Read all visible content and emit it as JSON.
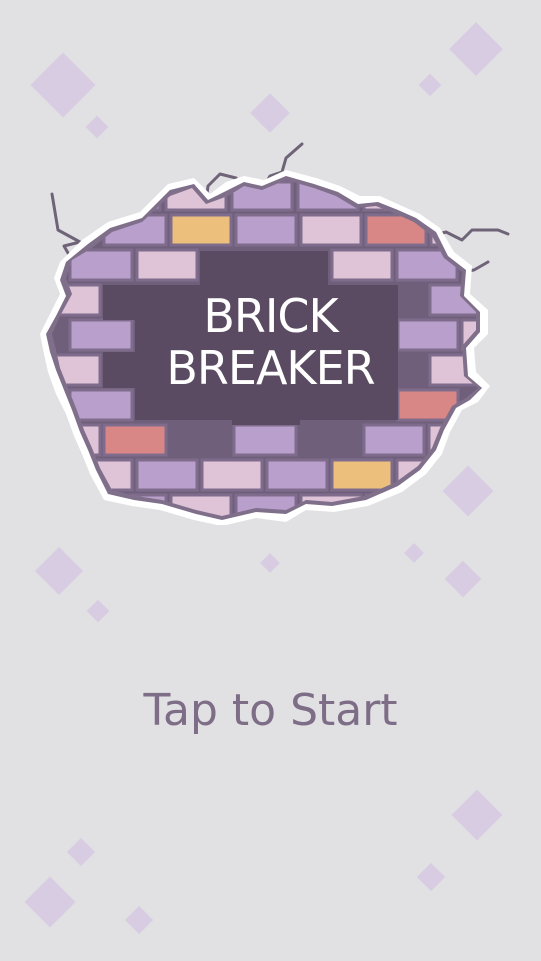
{
  "game": {
    "title_line1": "BRICK",
    "title_line2": "BREAKER",
    "start_prompt": "Tap to Start"
  },
  "colors": {
    "background": "#e1e1e3",
    "dark_panel": "#5b4b62",
    "brick_lavender": "#b9a0cc",
    "brick_pink": "#dfc3d6",
    "brick_orange": "#ecc07c",
    "brick_red": "#d98786",
    "prompt_text": "#7d6d87",
    "diamond": "#d8cce2"
  }
}
